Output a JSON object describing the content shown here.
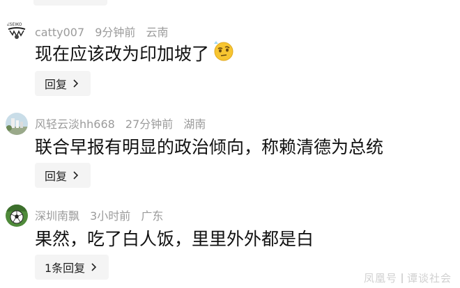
{
  "comments": [
    {
      "username": "catty007",
      "time": "9分钟前",
      "location": "云南",
      "text": "现在应该改为印加坡了",
      "emoji_icon": "thinking-face-emoji-icon",
      "reply_label": "回复"
    },
    {
      "username": "风轻云淡hh668",
      "time": "27分钟前",
      "location": "湖南",
      "text": "联合早报有明显的政治倾向，称赖清德为总统",
      "reply_label": "回复"
    },
    {
      "username": "深圳南飘",
      "time": "3小时前",
      "location": "广东",
      "text": "果然，吃了白人饭，里里外外都是白",
      "reply_label": "1条回复"
    }
  ],
  "watermark": {
    "left": "凤凰号",
    "right": "谭谈社会"
  },
  "colors": {
    "meta": "#9b9b9b",
    "text": "#111111",
    "button_bg": "#f4f4f4"
  }
}
